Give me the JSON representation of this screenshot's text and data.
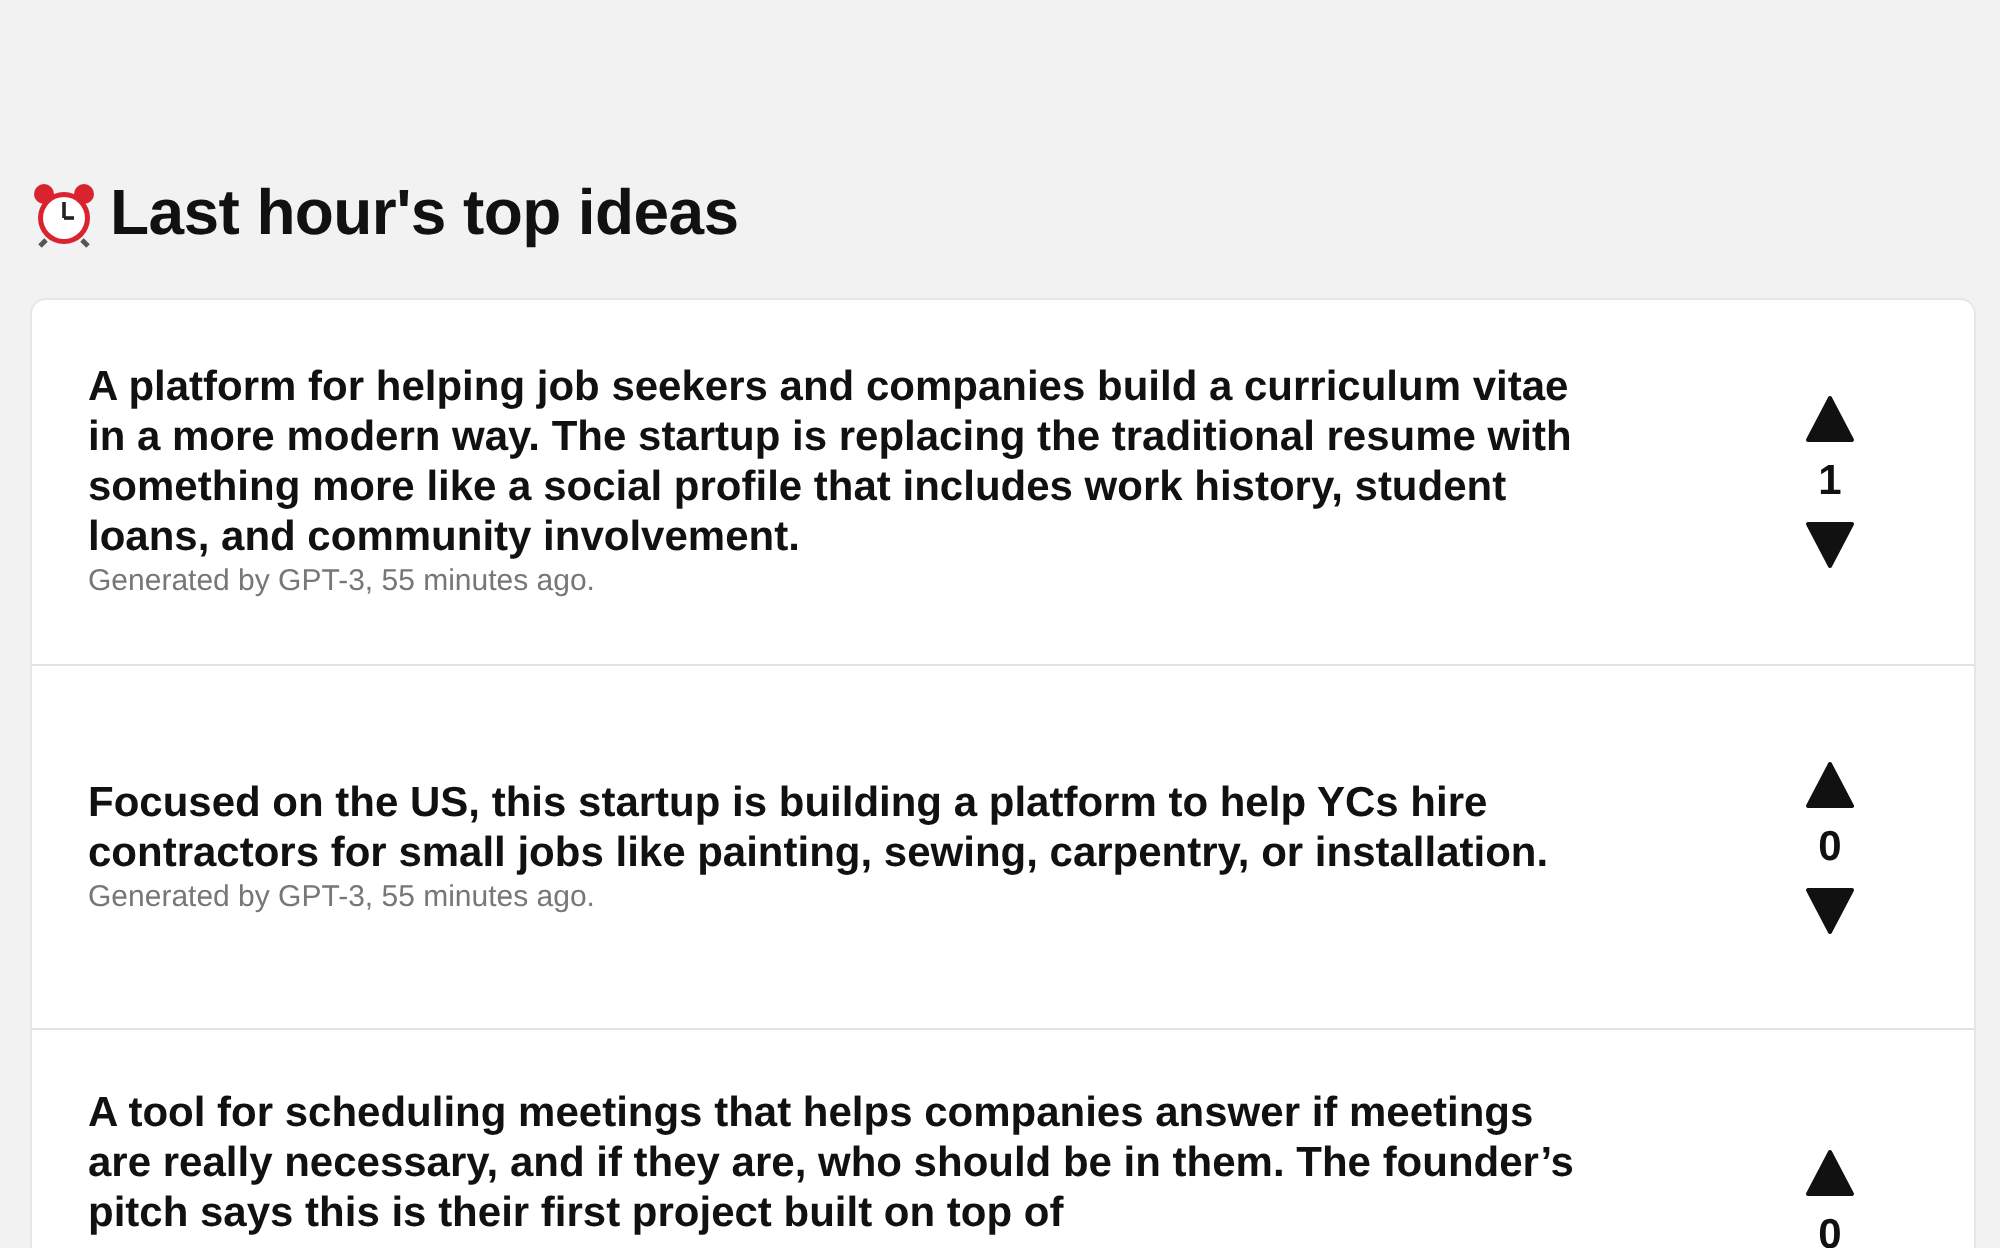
{
  "heading": {
    "title": "Last hour's top ideas"
  },
  "ideas": [
    {
      "text": "A platform for helping job seekers and companies build a curriculum vitae in a more modern way. The startup is replacing the traditional resume with something more like a social profile that includes work history, student loans, and community involvement.",
      "meta": "Generated by GPT-3, 55 minutes ago.",
      "votes": "1"
    },
    {
      "text": "Focused on the US, this startup is building a platform to help YCs hire contractors for small jobs like painting, sewing, carpentry, or installation.",
      "meta": "Generated by GPT-3, 55 minutes ago.",
      "votes": "0"
    },
    {
      "text": "A tool for scheduling meetings that helps companies answer if meetings are really necessary, and if they are, who should be in them. The founder’s pitch says this is their first project built on top of",
      "votes": "0"
    }
  ]
}
